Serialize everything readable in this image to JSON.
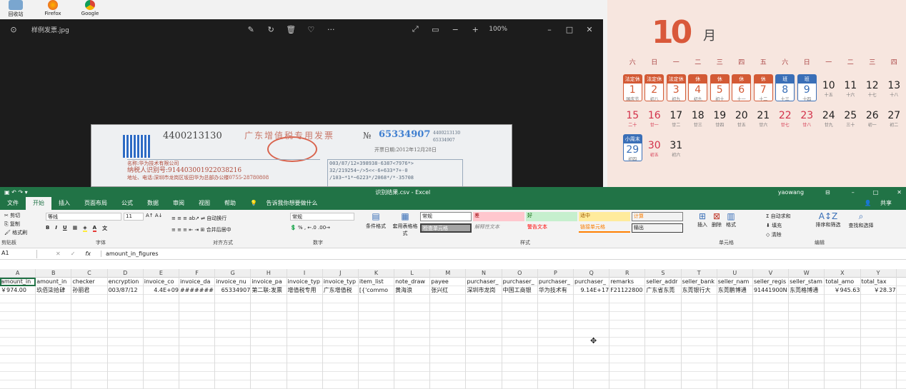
{
  "desktop": {
    "icons": [
      {
        "label": "回收站"
      },
      {
        "label": "Firefox"
      },
      {
        "label": "Google"
      }
    ]
  },
  "viewer": {
    "filename": "样例发票.jpg",
    "zoom": "100%",
    "invoice": {
      "code": "4400213130",
      "title": "广东增值税专用发票",
      "no_symbol": "№",
      "number": "65334907",
      "lines": [
        "名称:华为技术有限公司",
        "纳税人识别号:914403001922038216",
        "地址、电话:深圳市龙岗区坂田华为总部办公楼0755-28780808"
      ],
      "cipher": [
        "003/87/12+398938-6387<7976*>",
        "32/219254~/>5<<-6+633*7+-0",
        "/103~*1*~6223*/2068*/*-35708"
      ],
      "side_code": "4400213130",
      "side_no": "65334907",
      "date": "开票日期:2012年12月28日"
    }
  },
  "calendar": {
    "month_num": "10",
    "month_char": "月",
    "weekdays": [
      "六",
      "日",
      "一",
      "二",
      "三",
      "四",
      "五",
      "六",
      "日",
      "一",
      "二",
      "三",
      "四"
    ],
    "rows": [
      [
        {
          "tag": "法定休",
          "n": "1",
          "l": "国庆节",
          "kind": "hol"
        },
        {
          "tag": "法定休",
          "n": "2",
          "l": "初八",
          "kind": "hol"
        },
        {
          "tag": "法定休",
          "n": "3",
          "l": "初九",
          "kind": "hol"
        },
        {
          "tag": "休",
          "n": "4",
          "l": "初九",
          "kind": "hol"
        },
        {
          "tag": "休",
          "n": "5",
          "l": "初十",
          "kind": "hol"
        },
        {
          "tag": "休",
          "n": "6",
          "l": "十一",
          "kind": "hol"
        },
        {
          "tag": "休",
          "n": "7",
          "l": "十二",
          "kind": "hol"
        },
        {
          "tag": "班",
          "n": "8",
          "l": "十三",
          "kind": "work"
        },
        {
          "tag": "班",
          "n": "9",
          "l": "十四",
          "kind": "work"
        },
        {
          "n": "10",
          "l": "十五"
        },
        {
          "n": "11",
          "l": "十六"
        },
        {
          "n": "12",
          "l": "十七"
        },
        {
          "n": "13",
          "l": "十八"
        }
      ],
      [
        {
          "n": "15",
          "l": "二十",
          "kind": "red"
        },
        {
          "n": "16",
          "l": "廿一",
          "kind": "red"
        },
        {
          "n": "17",
          "l": "廿二"
        },
        {
          "n": "18",
          "l": "廿三"
        },
        {
          "n": "19",
          "l": "廿四"
        },
        {
          "n": "20",
          "l": "廿五"
        },
        {
          "n": "21",
          "l": "廿六"
        },
        {
          "n": "22",
          "l": "廿七",
          "kind": "red"
        },
        {
          "n": "23",
          "l": "廿八",
          "kind": "red"
        },
        {
          "n": "24",
          "l": "廿九"
        },
        {
          "n": "25",
          "l": "三十"
        },
        {
          "n": "26",
          "l": "初一"
        },
        {
          "n": "27",
          "l": "初二"
        }
      ],
      [
        {
          "tag": "小周末",
          "n": "29",
          "l": "初四",
          "kind": "work"
        },
        {
          "n": "30",
          "l": "初五",
          "kind": "red"
        },
        {
          "n": "31",
          "l": "初六"
        }
      ]
    ]
  },
  "excel": {
    "filename": "识别结果.csv",
    "app": "Excel",
    "user": "yaowang",
    "share": "共享",
    "tabs": [
      "文件",
      "开始",
      "插入",
      "页面布局",
      "公式",
      "数据",
      "审阅",
      "视图",
      "帮助"
    ],
    "tell_me": "告诉我你想要做什么",
    "clipboard": {
      "cut": "剪切",
      "copy": "复制",
      "format_painter": "格式刷",
      "group": "剪贴板"
    },
    "font": {
      "name": "等线",
      "size": "11",
      "group": "字体"
    },
    "align": {
      "wrap": "自动换行",
      "merge": "合并后居中",
      "group": "对齐方式"
    },
    "number": {
      "format": "常规",
      "group": "数字"
    },
    "styles": {
      "conditional": "条件格式",
      "table": "套用表格格式",
      "items": [
        "常规",
        "差",
        "好",
        "适中",
        "计算",
        "检查单元格",
        "解释性文本",
        "警告文本",
        "链接单元格",
        "输出"
      ],
      "group": "样式"
    },
    "cells": {
      "insert": "插入",
      "delete": "删除",
      "format": "格式",
      "group": "单元格"
    },
    "editing": {
      "autosum": "自动求和",
      "fill": "填充",
      "clear": "清除",
      "sort": "排序和筛选",
      "find": "查找和选择",
      "group": "编辑"
    },
    "namebox": "A1",
    "formula": "amount_in_figures",
    "columns": [
      "A",
      "B",
      "C",
      "D",
      "E",
      "F",
      "G",
      "H",
      "I",
      "J",
      "K",
      "L",
      "M",
      "N",
      "O",
      "P",
      "Q",
      "R",
      "S",
      "T",
      "U",
      "V",
      "W",
      "X",
      "Y"
    ],
    "headers": [
      "amount_in",
      "amount_in",
      "checker",
      "encryption",
      "invoice_co",
      "invoice_da",
      "invoice_nu",
      "invoice_pa",
      "invoice_typ",
      "invoice_typ",
      "item_list",
      "note_draw",
      "payee",
      "purchaser_",
      "purchaser_",
      "purchaser_",
      "purchaser_",
      "remarks",
      "seller_addr",
      "seller_bank",
      "seller_nam",
      "seller_regis",
      "seller_stam",
      "total_amo",
      "total_tax"
    ],
    "row2": [
      "￥974.00",
      "玖佰柒拾肆",
      "孙丽君",
      "003/87/12",
      "4.4E+09",
      "#######",
      "65334907",
      "第二联:发票",
      "增值税专用",
      "广东增值税",
      "[{'commo",
      "黄海浪",
      "张兴红",
      "深圳市龙岗",
      "中国工商银",
      "华为技术有",
      "9.14E+17",
      "F21122800",
      "广东省东莞",
      "东莞银行大",
      "东莞鹏博通",
      "91441900N",
      "东莞格博通",
      "￥945.63",
      "￥28.37"
    ]
  }
}
